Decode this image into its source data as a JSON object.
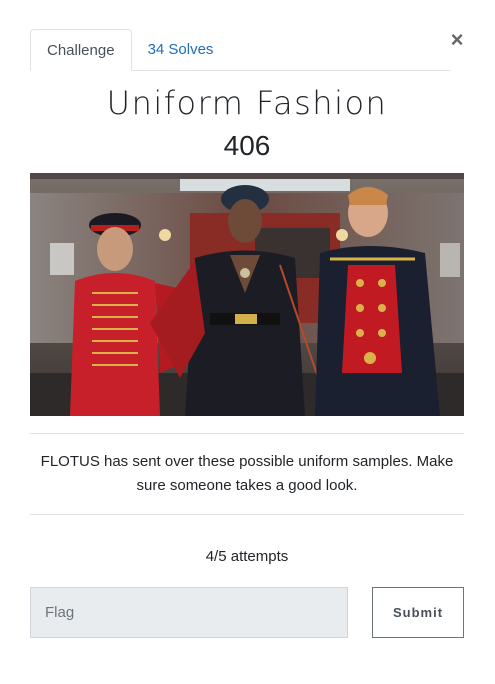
{
  "tabs": {
    "challenge": "Challenge",
    "solves": "34 Solves"
  },
  "close_glyph": "×",
  "challenge": {
    "name": "Uniform Fashion",
    "value": "406",
    "description": "FLOTUS has sent over these possible uniform samples. Make sure someone takes a good look.",
    "attempts": "4/5 attempts"
  },
  "form": {
    "flag_placeholder": "Flag",
    "submit_label": "Submit"
  },
  "colors": {
    "link": "#1e6fb8",
    "border": "#dee2e6",
    "input_bg": "#e9ecef"
  }
}
